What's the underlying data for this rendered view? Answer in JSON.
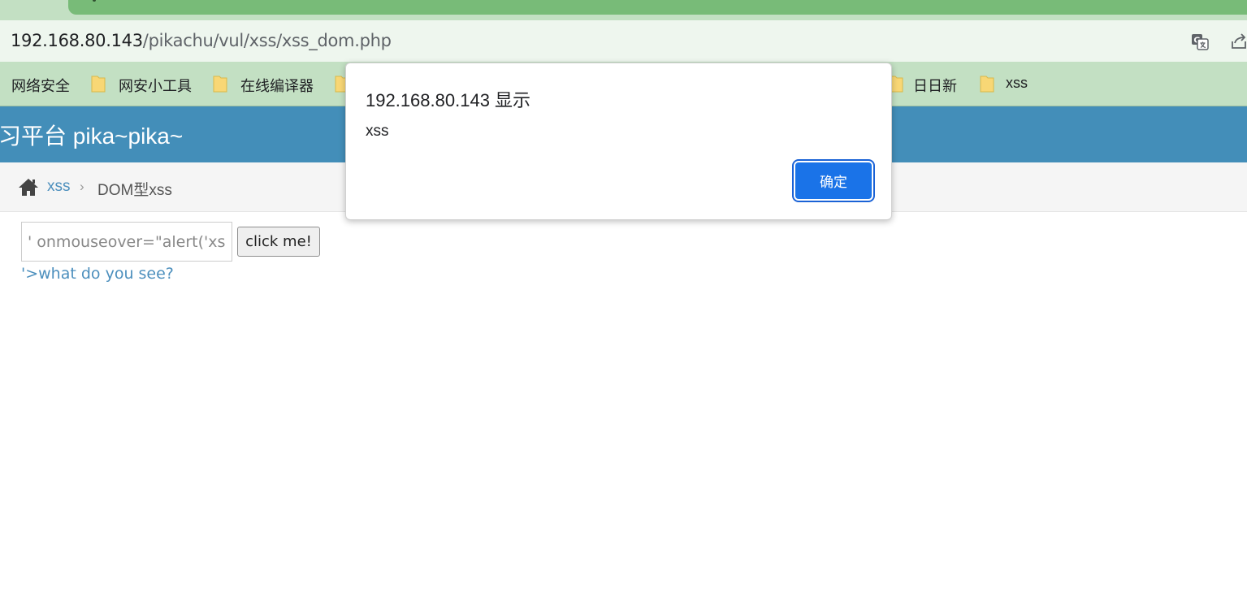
{
  "browser": {
    "url_host": "192.168.80.143",
    "url_path": "/pikachu/vul/xss/xss_dom.php",
    "icons": [
      "translate-icon",
      "share-icon",
      "folder-icon",
      "home-icon"
    ],
    "bookmarks": [
      {
        "label": "网络安全",
        "folder": false
      },
      {
        "label": "网安小工具",
        "folder": true
      },
      {
        "label": "在线编译器",
        "folder": true
      },
      {
        "label": "日日新",
        "folder": true
      },
      {
        "label": "xss",
        "folder": true
      }
    ]
  },
  "page": {
    "header_title": "习平台 pika~pika~",
    "breadcrumb": {
      "link": "xss",
      "separator": "›",
      "current": "DOM型xss"
    },
    "input_value": "' onmouseover=\"alert('xss')\">",
    "button_label": "click me!",
    "result_link": "'>what do you see?"
  },
  "dialog": {
    "title": "192.168.80.143 显示",
    "message": "xss",
    "ok_label": "确定"
  },
  "colors": {
    "header_blue": "#438eb9",
    "link_blue": "#4c8fbd",
    "chrome_green": "#c3e0c3",
    "tab_green": "#78bb78",
    "ok_button": "#1a73e8"
  }
}
